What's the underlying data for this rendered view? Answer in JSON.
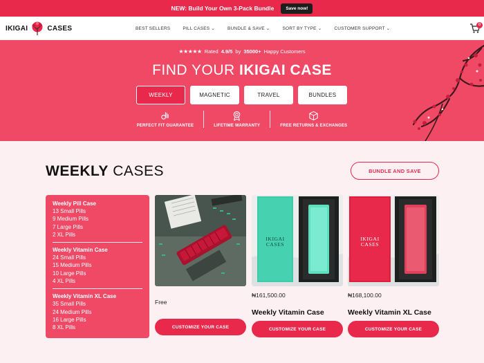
{
  "announcement": {
    "text": "NEW: Build Your Own 3-Pack Bundle",
    "button": "Save now!"
  },
  "brand": {
    "name_left": "IKIGAI",
    "name_right": "CASES"
  },
  "nav": {
    "items": [
      "BEST SELLERS",
      "PILL CASES",
      "BUNDLE & SAVE",
      "SORT BY TYPE",
      "CUSTOMER SUPPORT"
    ]
  },
  "cart": {
    "count": "0"
  },
  "hero": {
    "stars": "★★★★★",
    "rating_prefix": "Rated",
    "rating_value": "4.9/5",
    "rating_by": "by",
    "rating_count": "35000+",
    "rating_suffix": "Happy Customers",
    "title_light": "FIND YOUR",
    "title_bold": "IKIGAI CASE",
    "tabs": [
      "WEEKLY",
      "MAGNETIC",
      "TRAVEL",
      "BUNDLES"
    ],
    "active_tab": "WEEKLY",
    "features": [
      "PERFECT FIT GUARANTEE",
      "LIFETIME WARRANTY",
      "FREE RETURNS & EXCHANGES"
    ]
  },
  "section": {
    "title_bold": "WEEKLY",
    "title_light": "CASES",
    "bundle_button": "BUNDLE AND SAVE"
  },
  "specs": [
    {
      "title": "Weekly Pill Case",
      "lines": [
        "13 Small Pills",
        "9 Medium Pills",
        "7 Large Pills",
        "2 XL Pills"
      ]
    },
    {
      "title": "Weekly Vitamin Case",
      "lines": [
        "24 Small Pills",
        "15 Medium Pills",
        "10 Large Pills",
        "4 XL Pills"
      ]
    },
    {
      "title": "Weekly Vitamin XL Case",
      "lines": [
        "35 Small Pills",
        "24 Medium Pills",
        "16 Large Pills",
        "8 XL Pills"
      ]
    }
  ],
  "products": [
    {
      "price": "Free",
      "name": "",
      "cta": "CUSTOMIZE YOUR CASE"
    },
    {
      "price": "₦161,500.00",
      "name": "Weekly Vitamin Case",
      "cta": "CUSTOMIZE YOUR CASE",
      "box_label_1": "IKIGAI",
      "box_label_2": "CASES"
    },
    {
      "price": "₦168,100.00",
      "name": "Weekly Vitamin XL Case",
      "cta": "CUSTOMIZE YOUR CASE",
      "box_label_1": "IKIGAI",
      "box_label_2": "CASES"
    }
  ],
  "colors": {
    "accent": "#e8294c",
    "hero_bg": "#ef4966",
    "page_bg": "#fdf0f2",
    "teal": "#3ec9a7"
  }
}
